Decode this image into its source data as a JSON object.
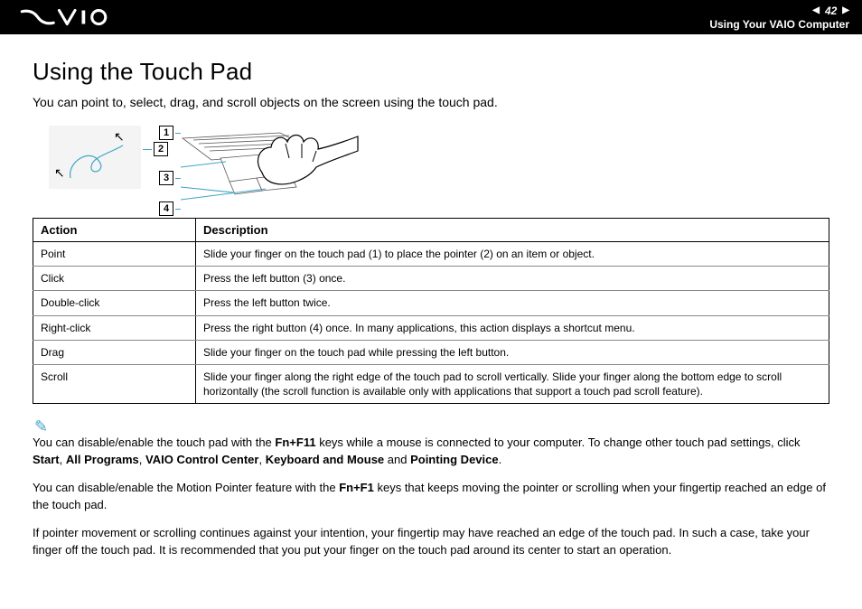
{
  "header": {
    "page_number": "42",
    "breadcrumb": "Using Your VAIO Computer"
  },
  "title": "Using the Touch Pad",
  "intro": "You can point to, select, drag, and scroll objects on the screen using the touch pad.",
  "callouts": {
    "c1": "1",
    "c2": "2",
    "c3": "3",
    "c4": "4"
  },
  "table": {
    "head_action": "Action",
    "head_desc": "Description",
    "rows": [
      {
        "action": "Point",
        "desc": "Slide your finger on the touch pad (1) to place the pointer (2) on an item or object."
      },
      {
        "action": "Click",
        "desc": "Press the left button (3) once."
      },
      {
        "action": "Double-click",
        "desc": "Press the left button twice."
      },
      {
        "action": "Right-click",
        "desc": "Press the right button (4) once. In many applications, this action displays a shortcut menu."
      },
      {
        "action": "Drag",
        "desc": "Slide your finger on the touch pad while pressing the left button."
      },
      {
        "action": "Scroll",
        "desc": "Slide your finger along the right edge of the touch pad to scroll vertically. Slide your finger along the bottom edge to scroll horizontally (the scroll function is available only with applications that support a touch pad scroll feature)."
      }
    ]
  },
  "notes": {
    "n1_a": "You can disable/enable the touch pad with the ",
    "n1_key1": "Fn+F11",
    "n1_b": " keys while a mouse is connected to your computer. To change other touch pad settings, click ",
    "n1_s1": "Start",
    "n1_s2": "All Programs",
    "n1_s3": "VAIO Control Center",
    "n1_s4": "Keyboard and Mouse",
    "n1_s5": "Pointing Device",
    "n2_a": "You can disable/enable the Motion Pointer feature with the ",
    "n2_key": "Fn+F1",
    "n2_b": " keys that keeps moving the pointer or scrolling when your fingertip reached an edge of the touch pad.",
    "n3": "If pointer movement or scrolling continues against your intention, your fingertip may have reached an edge of the touch pad. In such a case, take your finger off the touch pad. It is recommended that you put your finger on the touch pad around its center to start an operation."
  }
}
